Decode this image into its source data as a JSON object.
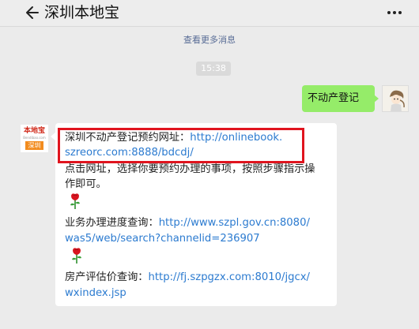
{
  "header": {
    "title": "深圳本地宝",
    "back_icon": "arrow-left-icon",
    "more_icon": "more-dots-icon"
  },
  "chat": {
    "view_more_label": "查看更多消息",
    "timestamp": "15:38",
    "sent_message": "不动产登记",
    "received": {
      "avatar": {
        "logo_top": "本地宝",
        "logo_sub": "Bendibao.com",
        "logo_city": "深圳"
      },
      "line1_text": "深圳不动产登记预约网址：",
      "line1_link": "http://onlinebook.",
      "line2_link": "szreorc.com:8888/bdcdj/",
      "line3_text": "点击网址，选择你要预约办理的事项，按照步骤指示操",
      "line4_text": "作即可。",
      "line6_text": "业务办理进度查询：",
      "line6_link": "http://www.szpl.gov.cn:8080/",
      "line7_link": "was5/web/search?channelid=236907",
      "line9_text": "房产评估价查询：",
      "line9_link": "http://fj.szpgzx.com:8010/jgcx/",
      "line10_link": "wxindex.jsp",
      "emoji_icon": "rose-icon"
    }
  },
  "colors": {
    "background": "#ebebeb",
    "sent_bubble": "#95ec69",
    "link": "#2c7bd0",
    "view_more": "#576b95",
    "highlight": "#e0141e"
  }
}
